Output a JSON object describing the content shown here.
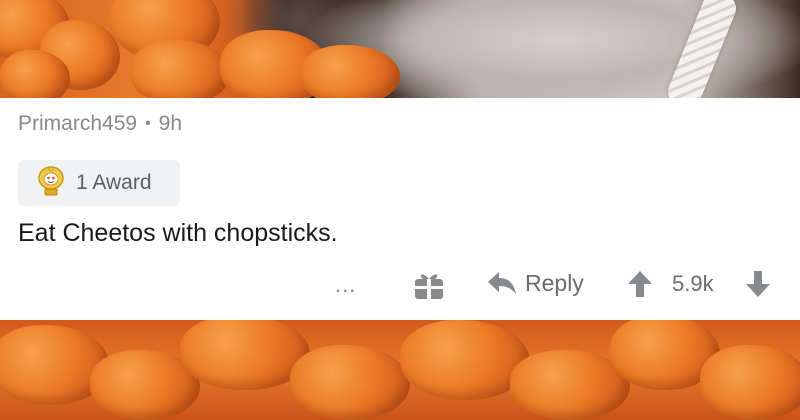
{
  "comment": {
    "username": "Primarch459",
    "separator": "•",
    "age": "9h",
    "award_label": "1 Award",
    "body": "Eat Cheetos with chopsticks."
  },
  "actions": {
    "more_label": "...",
    "reply_label": "Reply",
    "score": "5.9k"
  },
  "icons": {
    "award": "award-medal-icon",
    "gift": "gift-icon",
    "reply": "reply-arrow-icon",
    "upvote": "upvote-arrow-icon",
    "downvote": "downvote-arrow-icon"
  },
  "colors": {
    "meta_text": "#878a8c",
    "body_text": "#1a1a1b",
    "pill_bg": "#f1f2f3",
    "action_text": "#6a6d70"
  }
}
